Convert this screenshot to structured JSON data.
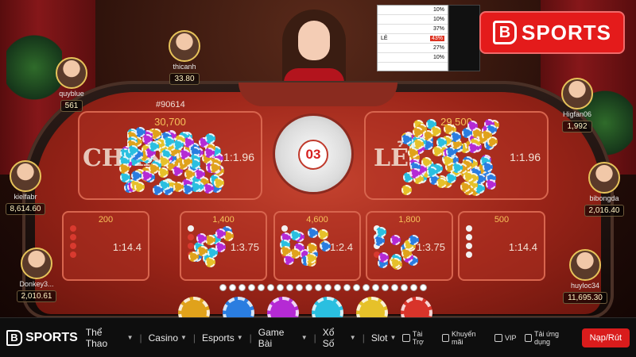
{
  "game": {
    "round_id": "#90614",
    "counter": "03",
    "main_bets": [
      {
        "side": "CHẴN",
        "amount": "30,700",
        "odds": "1:1.96"
      },
      {
        "side": "LẺ",
        "amount": "29,500",
        "odds": "1:1.96"
      }
    ],
    "side_bets": [
      {
        "amount": "200",
        "odds": "1:14.4"
      },
      {
        "amount": "1,400",
        "odds": "1:3.75"
      },
      {
        "amount": "4,600",
        "odds": "1:2.4"
      },
      {
        "amount": "1,800",
        "odds": "1:3.75"
      },
      {
        "amount": "500",
        "odds": "1:14.4"
      }
    ]
  },
  "players": [
    {
      "name": "thicanh",
      "balance": "33.80"
    },
    {
      "name": "quyblue",
      "balance": "561"
    },
    {
      "name": "kielfabr",
      "balance": "8,614.60"
    },
    {
      "name": "Donkey3...",
      "balance": "2,010.61"
    },
    {
      "name": "Higfan06",
      "balance": "1,992"
    },
    {
      "name": "bibongda",
      "balance": "2,016.40"
    },
    {
      "name": "huyloc34",
      "balance": "11,695.30"
    }
  ],
  "road": {
    "rows": [
      {
        "label": "",
        "pct": "10%"
      },
      {
        "label": "",
        "pct": "10%"
      },
      {
        "label": "",
        "pct": "37%"
      },
      {
        "label": "LẺ",
        "pct": "43%"
      },
      {
        "label": "",
        "pct": "27%"
      },
      {
        "label": "",
        "pct": "10%"
      }
    ]
  },
  "brand": {
    "mark": "B",
    "name": "SPORTS"
  },
  "navbar": {
    "logo_mark": "B",
    "logo_name": "SPORTS",
    "items": [
      "Thể Thao",
      "Casino",
      "Esports",
      "Game Bài",
      "Xổ Số",
      "Slot"
    ],
    "links": [
      "Tài Trợ",
      "Khuyến mãi",
      "VIP",
      "Tải ứng dụng"
    ],
    "cta": "Nạp/Rút"
  },
  "colors": {
    "accent": "#e41b1b",
    "felt": "#b3321f",
    "gold": "#f6c25a"
  }
}
